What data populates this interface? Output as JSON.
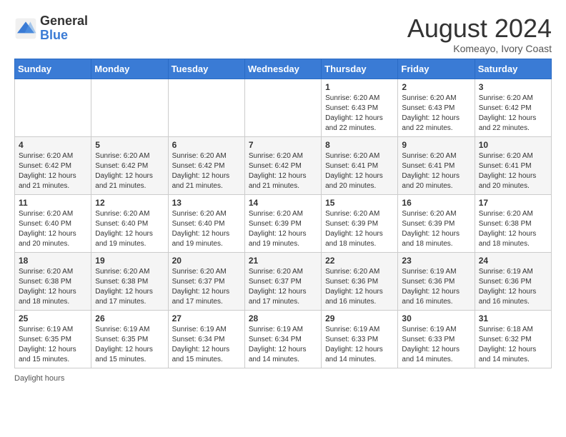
{
  "header": {
    "logo_general": "General",
    "logo_blue": "Blue",
    "month_title": "August 2024",
    "location": "Komeayo, Ivory Coast"
  },
  "days_of_week": [
    "Sunday",
    "Monday",
    "Tuesday",
    "Wednesday",
    "Thursday",
    "Friday",
    "Saturday"
  ],
  "footer": {
    "daylight_note": "Daylight hours"
  },
  "weeks": [
    [
      {
        "day": "",
        "sunrise": "",
        "sunset": "",
        "daylight": ""
      },
      {
        "day": "",
        "sunrise": "",
        "sunset": "",
        "daylight": ""
      },
      {
        "day": "",
        "sunrise": "",
        "sunset": "",
        "daylight": ""
      },
      {
        "day": "",
        "sunrise": "",
        "sunset": "",
        "daylight": ""
      },
      {
        "day": "1",
        "sunrise": "Sunrise: 6:20 AM",
        "sunset": "Sunset: 6:43 PM",
        "daylight": "Daylight: 12 hours and 22 minutes."
      },
      {
        "day": "2",
        "sunrise": "Sunrise: 6:20 AM",
        "sunset": "Sunset: 6:43 PM",
        "daylight": "Daylight: 12 hours and 22 minutes."
      },
      {
        "day": "3",
        "sunrise": "Sunrise: 6:20 AM",
        "sunset": "Sunset: 6:42 PM",
        "daylight": "Daylight: 12 hours and 22 minutes."
      }
    ],
    [
      {
        "day": "4",
        "sunrise": "Sunrise: 6:20 AM",
        "sunset": "Sunset: 6:42 PM",
        "daylight": "Daylight: 12 hours and 21 minutes."
      },
      {
        "day": "5",
        "sunrise": "Sunrise: 6:20 AM",
        "sunset": "Sunset: 6:42 PM",
        "daylight": "Daylight: 12 hours and 21 minutes."
      },
      {
        "day": "6",
        "sunrise": "Sunrise: 6:20 AM",
        "sunset": "Sunset: 6:42 PM",
        "daylight": "Daylight: 12 hours and 21 minutes."
      },
      {
        "day": "7",
        "sunrise": "Sunrise: 6:20 AM",
        "sunset": "Sunset: 6:42 PM",
        "daylight": "Daylight: 12 hours and 21 minutes."
      },
      {
        "day": "8",
        "sunrise": "Sunrise: 6:20 AM",
        "sunset": "Sunset: 6:41 PM",
        "daylight": "Daylight: 12 hours and 20 minutes."
      },
      {
        "day": "9",
        "sunrise": "Sunrise: 6:20 AM",
        "sunset": "Sunset: 6:41 PM",
        "daylight": "Daylight: 12 hours and 20 minutes."
      },
      {
        "day": "10",
        "sunrise": "Sunrise: 6:20 AM",
        "sunset": "Sunset: 6:41 PM",
        "daylight": "Daylight: 12 hours and 20 minutes."
      }
    ],
    [
      {
        "day": "11",
        "sunrise": "Sunrise: 6:20 AM",
        "sunset": "Sunset: 6:40 PM",
        "daylight": "Daylight: 12 hours and 20 minutes."
      },
      {
        "day": "12",
        "sunrise": "Sunrise: 6:20 AM",
        "sunset": "Sunset: 6:40 PM",
        "daylight": "Daylight: 12 hours and 19 minutes."
      },
      {
        "day": "13",
        "sunrise": "Sunrise: 6:20 AM",
        "sunset": "Sunset: 6:40 PM",
        "daylight": "Daylight: 12 hours and 19 minutes."
      },
      {
        "day": "14",
        "sunrise": "Sunrise: 6:20 AM",
        "sunset": "Sunset: 6:39 PM",
        "daylight": "Daylight: 12 hours and 19 minutes."
      },
      {
        "day": "15",
        "sunrise": "Sunrise: 6:20 AM",
        "sunset": "Sunset: 6:39 PM",
        "daylight": "Daylight: 12 hours and 18 minutes."
      },
      {
        "day": "16",
        "sunrise": "Sunrise: 6:20 AM",
        "sunset": "Sunset: 6:39 PM",
        "daylight": "Daylight: 12 hours and 18 minutes."
      },
      {
        "day": "17",
        "sunrise": "Sunrise: 6:20 AM",
        "sunset": "Sunset: 6:38 PM",
        "daylight": "Daylight: 12 hours and 18 minutes."
      }
    ],
    [
      {
        "day": "18",
        "sunrise": "Sunrise: 6:20 AM",
        "sunset": "Sunset: 6:38 PM",
        "daylight": "Daylight: 12 hours and 18 minutes."
      },
      {
        "day": "19",
        "sunrise": "Sunrise: 6:20 AM",
        "sunset": "Sunset: 6:38 PM",
        "daylight": "Daylight: 12 hours and 17 minutes."
      },
      {
        "day": "20",
        "sunrise": "Sunrise: 6:20 AM",
        "sunset": "Sunset: 6:37 PM",
        "daylight": "Daylight: 12 hours and 17 minutes."
      },
      {
        "day": "21",
        "sunrise": "Sunrise: 6:20 AM",
        "sunset": "Sunset: 6:37 PM",
        "daylight": "Daylight: 12 hours and 17 minutes."
      },
      {
        "day": "22",
        "sunrise": "Sunrise: 6:20 AM",
        "sunset": "Sunset: 6:36 PM",
        "daylight": "Daylight: 12 hours and 16 minutes."
      },
      {
        "day": "23",
        "sunrise": "Sunrise: 6:19 AM",
        "sunset": "Sunset: 6:36 PM",
        "daylight": "Daylight: 12 hours and 16 minutes."
      },
      {
        "day": "24",
        "sunrise": "Sunrise: 6:19 AM",
        "sunset": "Sunset: 6:36 PM",
        "daylight": "Daylight: 12 hours and 16 minutes."
      }
    ],
    [
      {
        "day": "25",
        "sunrise": "Sunrise: 6:19 AM",
        "sunset": "Sunset: 6:35 PM",
        "daylight": "Daylight: 12 hours and 15 minutes."
      },
      {
        "day": "26",
        "sunrise": "Sunrise: 6:19 AM",
        "sunset": "Sunset: 6:35 PM",
        "daylight": "Daylight: 12 hours and 15 minutes."
      },
      {
        "day": "27",
        "sunrise": "Sunrise: 6:19 AM",
        "sunset": "Sunset: 6:34 PM",
        "daylight": "Daylight: 12 hours and 15 minutes."
      },
      {
        "day": "28",
        "sunrise": "Sunrise: 6:19 AM",
        "sunset": "Sunset: 6:34 PM",
        "daylight": "Daylight: 12 hours and 14 minutes."
      },
      {
        "day": "29",
        "sunrise": "Sunrise: 6:19 AM",
        "sunset": "Sunset: 6:33 PM",
        "daylight": "Daylight: 12 hours and 14 minutes."
      },
      {
        "day": "30",
        "sunrise": "Sunrise: 6:19 AM",
        "sunset": "Sunset: 6:33 PM",
        "daylight": "Daylight: 12 hours and 14 minutes."
      },
      {
        "day": "31",
        "sunrise": "Sunrise: 6:18 AM",
        "sunset": "Sunset: 6:32 PM",
        "daylight": "Daylight: 12 hours and 14 minutes."
      }
    ]
  ]
}
